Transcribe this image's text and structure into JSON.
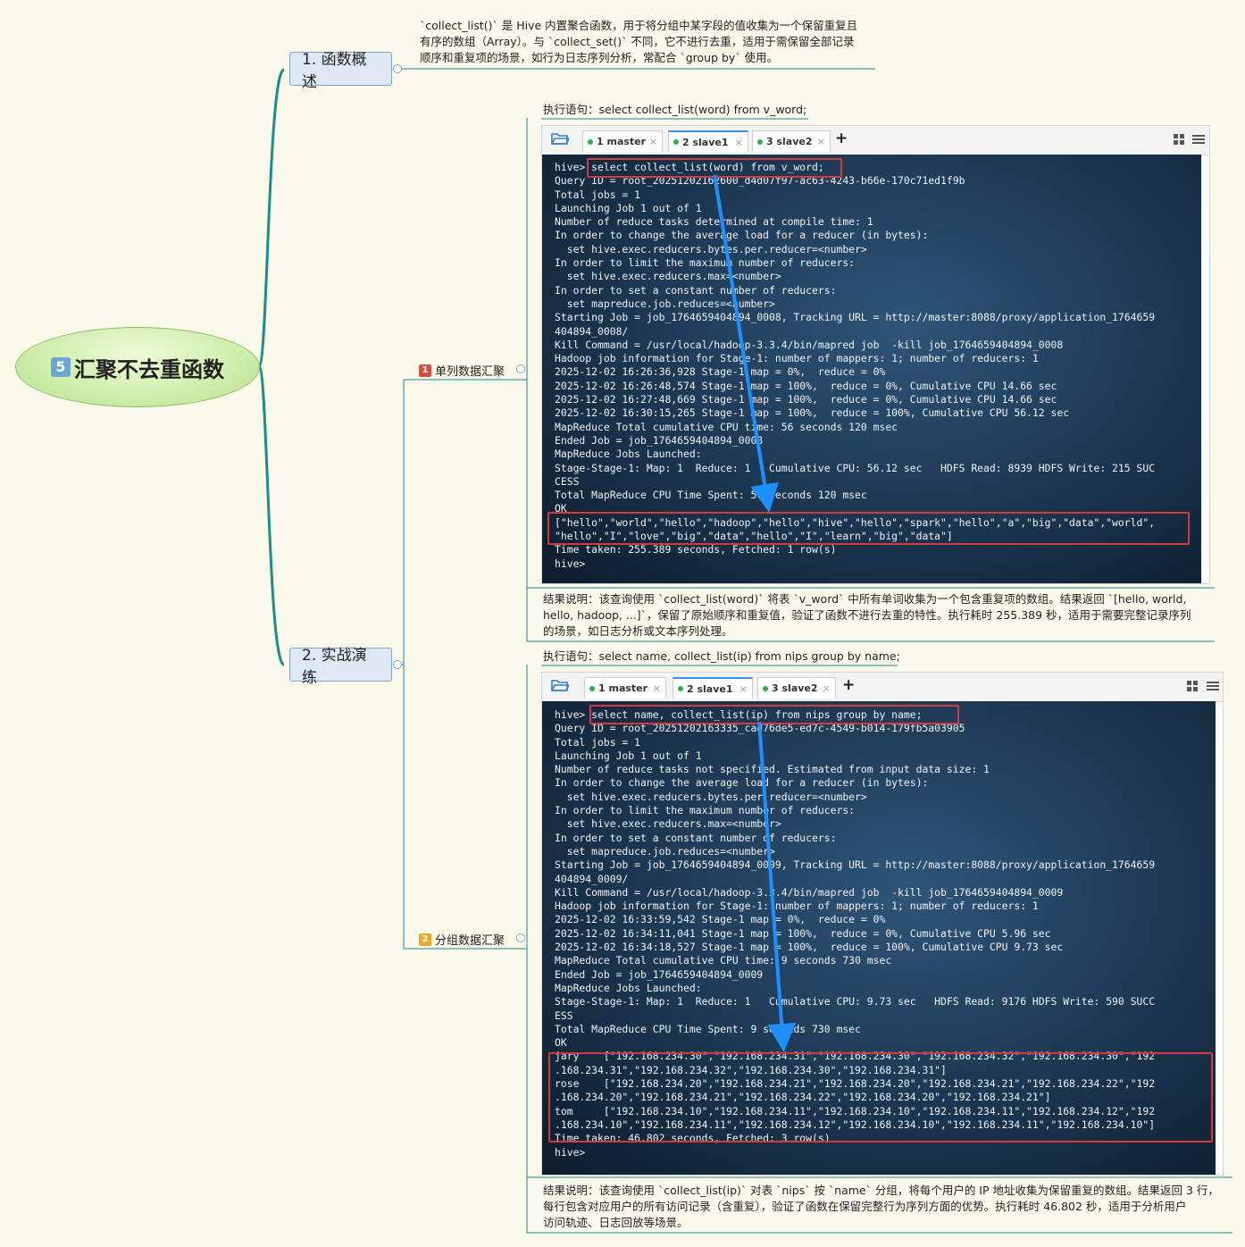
{
  "root": {
    "badge": "5",
    "title": "汇聚不去重函数"
  },
  "topics": [
    {
      "label": "1. 函数概述"
    },
    {
      "label": "2. 实战演练"
    }
  ],
  "overview_note": "`collect_list()` 是 Hive 内置聚合函数，用于将分组中某字段的值收集为一个保留重复且\n有序的数组（Array）。与 `collect_set()` 不同，它不进行去重，适用于需保留全部记录\n顺序和重复项的场景，如行为日志序列分析，常配合 `group by` 使用。",
  "subtopics": [
    {
      "badge": "1",
      "label": "单列数据汇聚",
      "badge_color": "#e04a3a"
    },
    {
      "badge": "2",
      "label": "分组数据汇聚",
      "badge_color": "#f1a52b"
    }
  ],
  "demo1": {
    "exec_label": "执行语句：select collect_list(word) from v_word;",
    "tabs": [
      {
        "label": "1 master"
      },
      {
        "label": "2 slave1"
      },
      {
        "label": "3 slave2"
      }
    ],
    "plus": "+",
    "terminal": "hive> select collect_list(word) from v_word;\nQuery ID = root_20251202162600_d4d07f97-ac63-4243-b66e-170c71ed1f9b\nTotal jobs = 1\nLaunching Job 1 out of 1\nNumber of reduce tasks determined at compile time: 1\nIn order to change the average load for a reducer (in bytes):\n  set hive.exec.reducers.bytes.per.reducer=<number>\nIn order to limit the maximum number of reducers:\n  set hive.exec.reducers.max=<number>\nIn order to set a constant number of reducers:\n  set mapreduce.job.reduces=<number>\nStarting Job = job_1764659404894_0008, Tracking URL = http://master:8088/proxy/application_1764659\n404894_0008/\nKill Command = /usr/local/hadoop-3.3.4/bin/mapred job  -kill job_1764659404894_0008\nHadoop job information for Stage-1: number of mappers: 1; number of reducers: 1\n2025-12-02 16:26:36,928 Stage-1 map = 0%,  reduce = 0%\n2025-12-02 16:26:48,574 Stage-1 map = 100%,  reduce = 0%, Cumulative CPU 14.66 sec\n2025-12-02 16:27:48,669 Stage-1 map = 100%,  reduce = 0%, Cumulative CPU 14.66 sec\n2025-12-02 16:30:15,265 Stage-1 map = 100%,  reduce = 100%, Cumulative CPU 56.12 sec\nMapReduce Total cumulative CPU time: 56 seconds 120 msec\nEnded Job = job_1764659404894_0008\nMapReduce Jobs Launched:\nStage-Stage-1: Map: 1  Reduce: 1   Cumulative CPU: 56.12 sec   HDFS Read: 8939 HDFS Write: 215 SUC\nCESS\nTotal MapReduce CPU Time Spent: 56 seconds 120 msec\nOK\n[\"hello\",\"world\",\"hello\",\"hadoop\",\"hello\",\"hive\",\"hello\",\"spark\",\"hello\",\"a\",\"big\",\"data\",\"world\",\n\"hello\",\"I\",\"love\",\"big\",\"data\",\"hello\",\"I\",\"learn\",\"big\",\"data\"]\nTime taken: 255.389 seconds, Fetched: 1 row(s)\nhive>",
    "result_note": "结果说明：该查询使用 `collect_list(word)` 将表 `v_word` 中所有单词收集为一个包含重复项的数组。结果返回 `[hello, world,\nhello, hadoop, ...]`，保留了原始顺序和重复值，验证了函数不进行去重的特性。执行耗时 255.389 秒，适用于需要完整记录序列\n的场景，如日志分析或文本序列处理。"
  },
  "demo2": {
    "exec_label": "执行语句：select name, collect_list(ip) from nips group by name;",
    "tabs": [
      {
        "label": "1 master"
      },
      {
        "label": "2 slave1"
      },
      {
        "label": "3 slave2"
      }
    ],
    "plus": "+",
    "terminal": "hive> select name, collect_list(ip) from nips group by name;\nQuery ID = root_20251202163335_cad76de5-ed7c-4549-b014-179fb5a03905\nTotal jobs = 1\nLaunching Job 1 out of 1\nNumber of reduce tasks not specified. Estimated from input data size: 1\nIn order to change the average load for a reducer (in bytes):\n  set hive.exec.reducers.bytes.per.reducer=<number>\nIn order to limit the maximum number of reducers:\n  set hive.exec.reducers.max=<number>\nIn order to set a constant number of reducers:\n  set mapreduce.job.reduces=<number>\nStarting Job = job_1764659404894_0009, Tracking URL = http://master:8088/proxy/application_1764659\n404894_0009/\nKill Command = /usr/local/hadoop-3.3.4/bin/mapred job  -kill job_1764659404894_0009\nHadoop job information for Stage-1: number of mappers: 1; number of reducers: 1\n2025-12-02 16:33:59,542 Stage-1 map = 0%,  reduce = 0%\n2025-12-02 16:34:11,041 Stage-1 map = 100%,  reduce = 0%, Cumulative CPU 5.96 sec\n2025-12-02 16:34:18,527 Stage-1 map = 100%,  reduce = 100%, Cumulative CPU 9.73 sec\nMapReduce Total cumulative CPU time: 9 seconds 730 msec\nEnded Job = job_1764659404894_0009\nMapReduce Jobs Launched:\nStage-Stage-1: Map: 1  Reduce: 1   Cumulative CPU: 9.73 sec   HDFS Read: 9176 HDFS Write: 590 SUCC\nESS\nTotal MapReduce CPU Time Spent: 9 seconds 730 msec\nOK\njary    [\"192.168.234.30\",\"192.168.234.31\",\"192.168.234.30\",\"192.168.234.32\",\"192.168.234.30\",\"192\n.168.234.31\",\"192.168.234.32\",\"192.168.234.30\",\"192.168.234.31\"]\nrose    [\"192.168.234.20\",\"192.168.234.21\",\"192.168.234.20\",\"192.168.234.21\",\"192.168.234.22\",\"192\n.168.234.20\",\"192.168.234.21\",\"192.168.234.22\",\"192.168.234.20\",\"192.168.234.21\"]\ntom     [\"192.168.234.10\",\"192.168.234.11\",\"192.168.234.10\",\"192.168.234.11\",\"192.168.234.12\",\"192\n.168.234.10\",\"192.168.234.11\",\"192.168.234.12\",\"192.168.234.10\",\"192.168.234.11\",\"192.168.234.10\"]\nTime taken: 46.802 seconds, Fetched: 3 row(s)\nhive>",
    "result_note": "结果说明：该查询使用 `collect_list(ip)` 对表 `nips` 按 `name` 分组，将每个用户的 IP 地址收集为保留重复的数组。结果返回 3 行，\n每行包含对应用户的所有访问记录（含重复），验证了函数在保留完整行为序列方面的优势。执行耗时 46.802 秒，适用于分析用户\n访问轨迹、日志回放等场景。"
  },
  "colors": {
    "arrow": "#1e8fff",
    "highlight": "#d43a3a",
    "branch": "#17908a"
  }
}
